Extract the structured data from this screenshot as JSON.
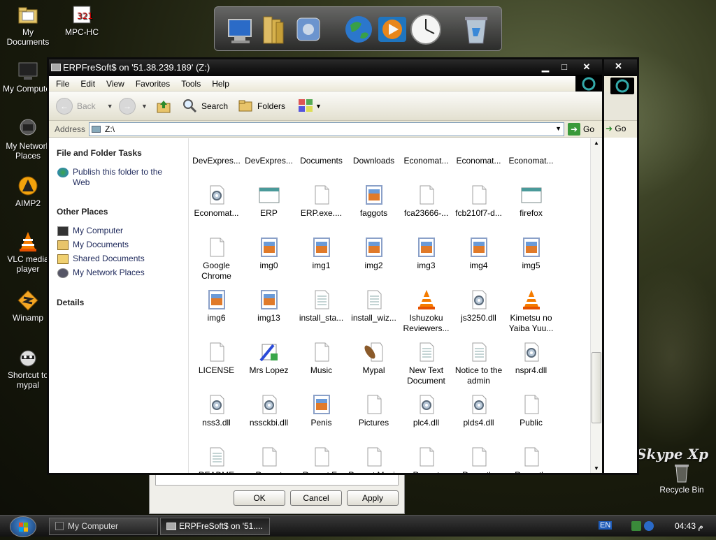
{
  "desktop": {
    "icons": [
      "My Documents",
      "MPC-HC",
      "My Computer",
      "My Network Places",
      "AIMP2",
      "VLC media player",
      "Winamp",
      "Shortcut to mypal",
      "Recycle Bin"
    ],
    "brand_text": "Skype Xp"
  },
  "window": {
    "title": "ERPFreSoft$ on '51.38.239.189' (Z:)"
  },
  "menu": [
    "File",
    "Edit",
    "View",
    "Favorites",
    "Tools",
    "Help"
  ],
  "toolbar": {
    "back": "Back",
    "search": "Search",
    "folders": "Folders"
  },
  "address": {
    "label": "Address",
    "value": "Z:\\",
    "go": "Go"
  },
  "left_pane": {
    "tasks_title": "File and Folder Tasks",
    "publish": "Publish this folder to the Web",
    "other_title": "Other Places",
    "other": [
      "My Computer",
      "My Documents",
      "Shared Documents",
      "My Network Places"
    ],
    "details_title": "Details"
  },
  "files": [
    {
      "name": "DevExpres...",
      "icon": "folder"
    },
    {
      "name": "DevExpres...",
      "icon": "folder"
    },
    {
      "name": "Documents",
      "icon": "folder"
    },
    {
      "name": "Downloads",
      "icon": "folder"
    },
    {
      "name": "Economat...",
      "icon": "folder"
    },
    {
      "name": "Economat...",
      "icon": "folder"
    },
    {
      "name": "Economat...",
      "icon": "folder"
    },
    {
      "name": "Economat...",
      "icon": "dll"
    },
    {
      "name": "ERP",
      "icon": "window"
    },
    {
      "name": "ERP.exe....",
      "icon": "doc"
    },
    {
      "name": "faggots",
      "icon": "image"
    },
    {
      "name": "fca23666-...",
      "icon": "doc"
    },
    {
      "name": "fcb210f7-d...",
      "icon": "doc"
    },
    {
      "name": "firefox",
      "icon": "window"
    },
    {
      "name": "Google Chrome",
      "icon": "doc"
    },
    {
      "name": "img0",
      "icon": "image"
    },
    {
      "name": "img1",
      "icon": "image"
    },
    {
      "name": "img2",
      "icon": "image"
    },
    {
      "name": "img3",
      "icon": "image"
    },
    {
      "name": "img4",
      "icon": "image"
    },
    {
      "name": "img5",
      "icon": "image"
    },
    {
      "name": "img6",
      "icon": "image"
    },
    {
      "name": "img13",
      "icon": "image"
    },
    {
      "name": "install_sta...",
      "icon": "text"
    },
    {
      "name": "install_wiz...",
      "icon": "text"
    },
    {
      "name": "Ishuzoku Reviewers...",
      "icon": "vlc"
    },
    {
      "name": "js3250.dll",
      "icon": "dll"
    },
    {
      "name": "Kimetsu no Yaiba Yuu...",
      "icon": "vlc"
    },
    {
      "name": "LICENSE",
      "icon": "doc"
    },
    {
      "name": "Mrs Lopez",
      "icon": "paint"
    },
    {
      "name": "Music",
      "icon": "doc"
    },
    {
      "name": "Mypal",
      "icon": "mypal"
    },
    {
      "name": "New Text Document",
      "icon": "text"
    },
    {
      "name": "Notice to the admin",
      "icon": "text"
    },
    {
      "name": "nspr4.dll",
      "icon": "dll"
    },
    {
      "name": "nss3.dll",
      "icon": "dll"
    },
    {
      "name": "nssckbi.dll",
      "icon": "dll"
    },
    {
      "name": "Penis",
      "icon": "image"
    },
    {
      "name": "Pictures",
      "icon": "doc"
    },
    {
      "name": "plc4.dll",
      "icon": "dll"
    },
    {
      "name": "plds4.dll",
      "icon": "dll"
    },
    {
      "name": "Public",
      "icon": "doc"
    },
    {
      "name": "README",
      "icon": "text"
    },
    {
      "name": "Recent Document...",
      "icon": "doc"
    },
    {
      "name": "Recent E-mail acc...",
      "icon": "doc"
    },
    {
      "name": "Recent Music acc...",
      "icon": "doc"
    },
    {
      "name": "Recent Pictures a...",
      "icon": "doc"
    },
    {
      "name": "Recently Changed...",
      "icon": "doc"
    },
    {
      "name": "Recently Changed...",
      "icon": "doc"
    }
  ],
  "dialog": {
    "ok": "OK",
    "cancel": "Cancel",
    "apply": "Apply"
  },
  "back_window": {
    "go": "Go"
  },
  "taskbar": {
    "items": [
      "My Computer",
      "ERPFreSoft$ on '51...."
    ],
    "lang": "EN",
    "clock": "04:43 م"
  }
}
